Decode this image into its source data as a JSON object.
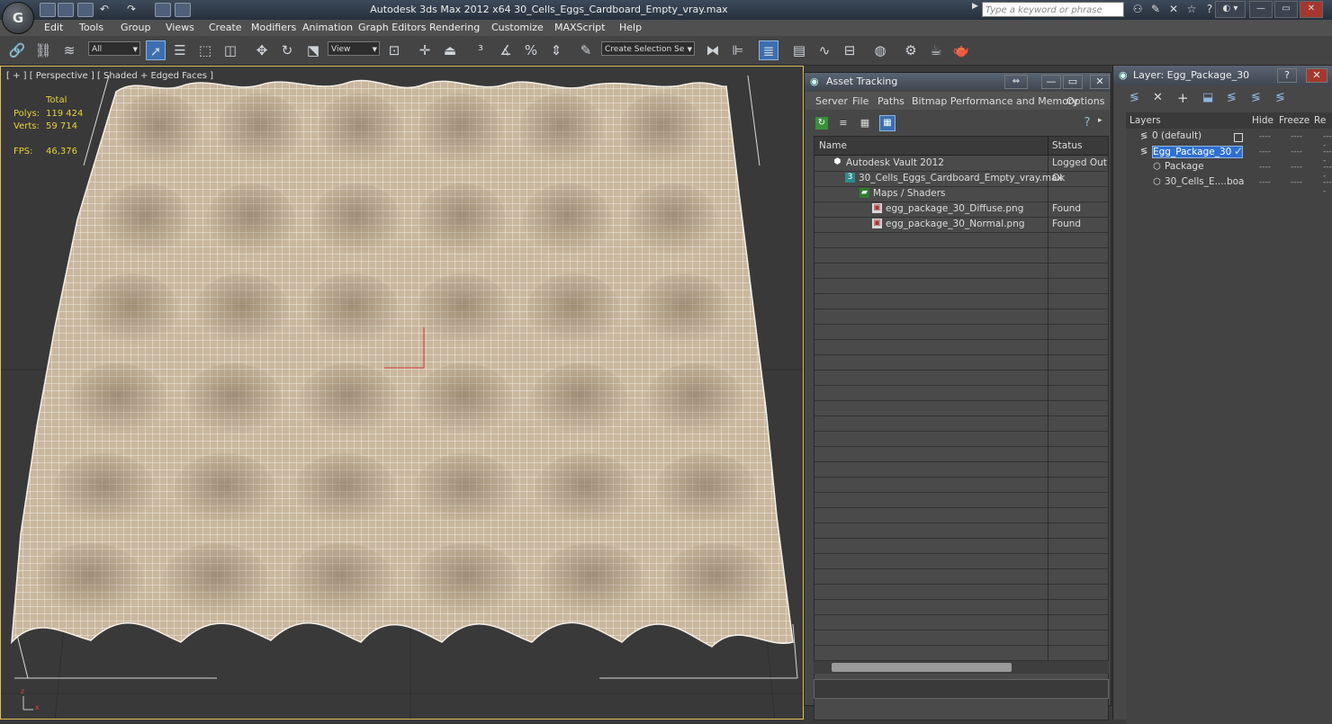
{
  "app": {
    "title": "Autodesk 3ds Max  2012 x64     30_Cells_Eggs_Cardboard_Empty_vray.max",
    "logo_letter": "G",
    "search_placeholder": "Type a keyword or phrase"
  },
  "menu": [
    "Edit",
    "Tools",
    "Group",
    "Views",
    "Create",
    "Modifiers",
    "Animation",
    "Graph Editors",
    "Rendering",
    "Customize",
    "MAXScript",
    "Help"
  ],
  "toolbar": {
    "selection_filter": "All",
    "reference_coord": "View",
    "named_selection": "Create Selection Se"
  },
  "viewport": {
    "label": "[ + ] [ Perspective ] [ Shaded + Edged Faces ]",
    "stats": {
      "total_label": "Total",
      "polys_label": "Polys:",
      "polys_value": "119 424",
      "verts_label": "Verts:",
      "verts_value": "59 714",
      "fps_label": "FPS:",
      "fps_value": "46,376"
    },
    "axis_z": "z",
    "axis_x": "x"
  },
  "asset_tracking": {
    "title": "Asset Tracking",
    "menu": [
      "Server",
      "File",
      "Paths",
      "Bitmap Performance and Memory",
      "Options"
    ],
    "columns": {
      "name": "Name",
      "status": "Status"
    },
    "rows": [
      {
        "name": "Autodesk Vault 2012",
        "status": "Logged Out ..."
      },
      {
        "name": "30_Cells_Eggs_Cardboard_Empty_vray.max",
        "status": "Ok"
      },
      {
        "name": "Maps / Shaders",
        "status": ""
      },
      {
        "name": "egg_package_30_Diffuse.png",
        "status": "Found"
      },
      {
        "name": "egg_package_30_Normal.png",
        "status": "Found"
      }
    ]
  },
  "layer_panel": {
    "title": "Layer: Egg_Package_30",
    "columns": {
      "layers": "Layers",
      "hide": "Hide",
      "freeze": "Freeze",
      "render": "Re"
    },
    "rows": [
      {
        "name": "0 (default)"
      },
      {
        "name": "Egg_Package_30"
      },
      {
        "name": "Package"
      },
      {
        "name": "30_Cells_E....boa"
      }
    ],
    "dash": "----"
  },
  "colors": {
    "mesh_fill": "#cbb9a0",
    "wire": "#f2ece3",
    "selection_blue": "#3c6fb0",
    "stats_yellow": "#e8d23a"
  }
}
